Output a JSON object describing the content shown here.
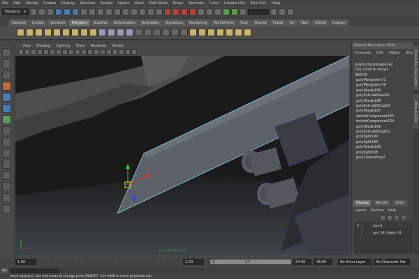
{
  "menus": [
    "File",
    "Edit",
    "Modify",
    "Create",
    "Display",
    "Window",
    "Assets",
    "Select",
    "Mesh",
    "Edit Mesh",
    "Proxy",
    "Normals",
    "Color",
    "Create UVs",
    "Edit UVs",
    "Help"
  ],
  "status": {
    "mode": "Polygons"
  },
  "shelf_tabs": [
    "General",
    "Curves",
    "Surfaces",
    "Polygons",
    "Subdivs",
    "Deformation",
    "Animation",
    "Dynamics",
    "Rendering",
    "PaintEffects",
    "Toon",
    "Muscle",
    "Fluids",
    "Fur",
    "Hair",
    "nCloth",
    "Custom"
  ],
  "active_shelf_tab": "Polygons",
  "panel_menu": [
    "View",
    "Shading",
    "Lighting",
    "Show",
    "Renderer",
    "Panels"
  ],
  "viewport": {
    "object_label": "gun_18:trigger_01"
  },
  "channel_box": {
    "title": "Channel Box / Layer Editor",
    "menu": [
      "Channels",
      "Edit",
      "Object",
      "Show"
    ],
    "object": "polySurfaceShape242",
    "cvs_hint": "CVs (click to show)",
    "inputs_label": "INPUTS",
    "history": [
      "polyMergeVert71",
      "polyMergeVert70",
      "polyTweak189",
      "polyExtrudeFace26",
      "polyTweak188",
      "polyExtrudeEdge52",
      "polyTweak187",
      "deleteComponent225",
      "deleteComponent224",
      "polyTweak186",
      "polyExtrudeEdge51",
      "polySplit190",
      "polySplit189",
      "polyTweak185",
      "polySplit188",
      "polyCreateFace2"
    ]
  },
  "layer_editor": {
    "tabs": [
      "Display",
      "Render",
      "Anim"
    ],
    "active_tab": "Display",
    "menu": [
      "Layers",
      "Options",
      "Help"
    ],
    "layers": [
      {
        "visible": "V",
        "name": "layer1"
      },
      {
        "visible": "",
        "name": "gun_18:trigger_01"
      }
    ]
  },
  "side_tabs": [
    "Channel Box / Layer Editor",
    "Attribute Editor"
  ],
  "time": {
    "start": "1.00",
    "playback_start": "1.00",
    "range_start_label": "1",
    "range_end_label": "24",
    "playback_end": "24.00",
    "end": "48.00",
    "anim_layer": "No Anim Layer",
    "char_set": "No Character Set"
  },
  "cmd": {
    "mel_label": "MEL"
  },
  "help_line": "move object(s). Use mid mode to change pivot (INSERT). Ctrl+LMB to move perpendicular.",
  "colors": {
    "wire_highlight": "#8fd0e8",
    "mesh_fill": "#5c6168",
    "manip_green": "#3ac83a",
    "manip_red": "#d23a3a",
    "manip_blue": "#3a4ad2"
  }
}
